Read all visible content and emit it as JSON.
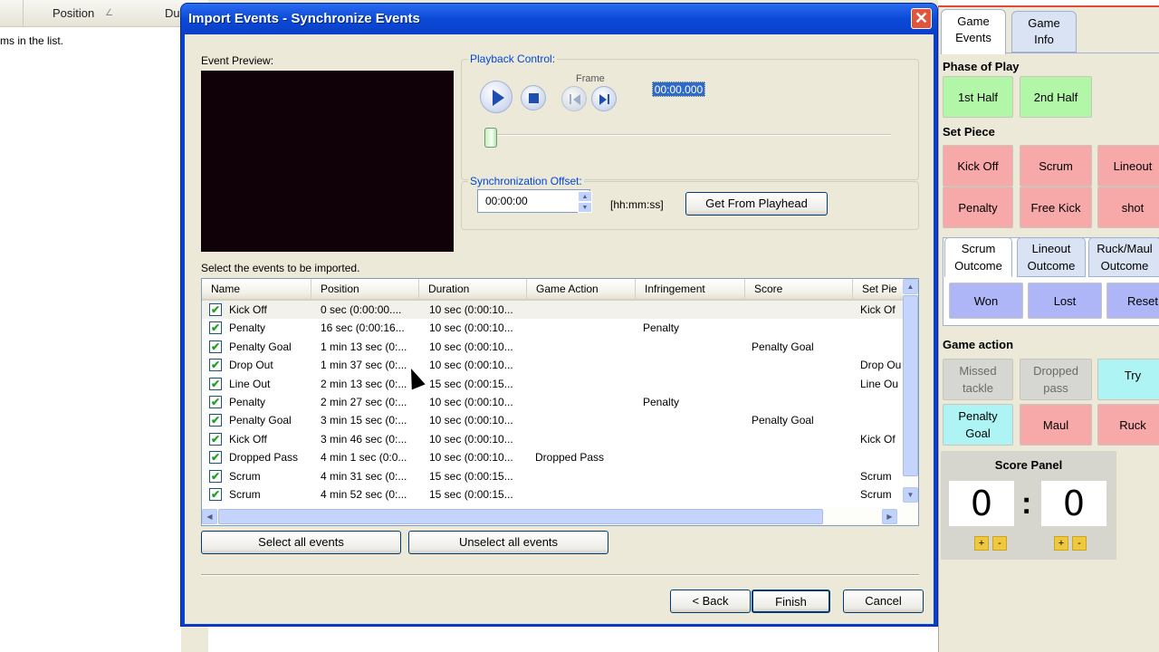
{
  "background": {
    "columns": [
      "Position",
      "Du"
    ],
    "empty_text": "ms in the list."
  },
  "dialog": {
    "title": "Import Events - Synchronize Events",
    "close_glyph": "✕",
    "event_preview_label": "Event Preview:",
    "playback": {
      "group_title": "Playback Control:",
      "frame_label": "Frame",
      "time": "00:00.000"
    },
    "sync": {
      "group_title": "Synchronization Offset:",
      "offset_value": "00:00:00",
      "format_label": "[hh:mm:ss]",
      "get_button": "Get From Playhead"
    },
    "select_label": "Select the events to be imported.",
    "columns": [
      "Name",
      "Position",
      "Duration",
      "Game Action",
      "Infringement",
      "Score",
      "Set Pie"
    ],
    "rows": [
      {
        "name": "Kick Off",
        "position": "0 sec (0:00:00....",
        "duration": "10 sec (0:00:10...",
        "action": "",
        "infringement": "",
        "score": "",
        "set": "Kick Of"
      },
      {
        "name": "Penalty",
        "position": "16 sec (0:00:16...",
        "duration": "10 sec (0:00:10...",
        "action": "",
        "infringement": "Penalty",
        "score": "",
        "set": ""
      },
      {
        "name": "Penalty Goal",
        "position": "1 min 13 sec (0:...",
        "duration": "10 sec (0:00:10...",
        "action": "",
        "infringement": "",
        "score": "Penalty Goal",
        "set": ""
      },
      {
        "name": "Drop Out",
        "position": "1 min 37 sec (0:...",
        "duration": "10 sec (0:00:10...",
        "action": "",
        "infringement": "",
        "score": "",
        "set": "Drop Ou"
      },
      {
        "name": "Line Out",
        "position": "2 min 13 sec (0:...",
        "duration": "15 sec (0:00:15...",
        "action": "",
        "infringement": "",
        "score": "",
        "set": "Line Ou"
      },
      {
        "name": "Penalty",
        "position": "2 min 27 sec (0:...",
        "duration": "10 sec (0:00:10...",
        "action": "",
        "infringement": "Penalty",
        "score": "",
        "set": ""
      },
      {
        "name": "Penalty Goal",
        "position": "3 min 15 sec (0:...",
        "duration": "10 sec (0:00:10...",
        "action": "",
        "infringement": "",
        "score": "Penalty Goal",
        "set": ""
      },
      {
        "name": "Kick Off",
        "position": "3 min 46 sec (0:...",
        "duration": "10 sec (0:00:10...",
        "action": "",
        "infringement": "",
        "score": "",
        "set": "Kick Of"
      },
      {
        "name": "Dropped Pass",
        "position": "4 min 1 sec (0:0...",
        "duration": "10 sec (0:00:10...",
        "action": "Dropped Pass",
        "infringement": "",
        "score": "",
        "set": ""
      },
      {
        "name": "Scrum",
        "position": "4 min 31 sec (0:...",
        "duration": "15 sec (0:00:15...",
        "action": "",
        "infringement": "",
        "score": "",
        "set": "Scrum"
      },
      {
        "name": "Scrum",
        "position": "4 min 52 sec (0:...",
        "duration": "15 sec (0:00:15...",
        "action": "",
        "infringement": "",
        "score": "",
        "set": "Scrum"
      }
    ],
    "select_all": "Select all events",
    "unselect_all": "Unselect all events",
    "back": "< Back",
    "finish": "Finish",
    "cancel": "Cancel"
  },
  "panel": {
    "tabs": [
      "Game\nEvents",
      "Game\nInfo"
    ],
    "phase_title": "Phase of Play",
    "phase_buttons": [
      "1st Half",
      "2nd Half"
    ],
    "set_piece_title": "Set Piece",
    "set_piece_buttons": [
      "Kick Off",
      "Scrum",
      "Lineout",
      "Penalty",
      "Free Kick",
      "shot"
    ],
    "outcome_tabs": [
      "Scrum\nOutcome",
      "Lineout\nOutcome",
      "Ruck/Maul\nOutcome"
    ],
    "outcome_buttons": [
      "Won",
      "Lost",
      "Reset"
    ],
    "game_action_title": "Game action",
    "game_action_buttons": [
      "Missed\ntackle",
      "Dropped\npass",
      "Try",
      "Penalty\nGoal",
      "Maul",
      "Ruck"
    ],
    "score_title": "Score Panel",
    "score_home": "0",
    "score_away": "0",
    "colon": ":",
    "plus": "+",
    "minus": "-"
  },
  "colors": {
    "title_bar": "#0a4ad8",
    "phase_green": "#b2f7a8",
    "set_piece_red": "#f7a8a8",
    "outcome_blue": "#aeb6f7",
    "action_cyan": "#aef4f4",
    "check_green": "#21a121"
  },
  "icons": [
    "play-icon",
    "stop-icon",
    "frame-back-icon",
    "frame-forward-icon",
    "close-icon",
    "checkbox-checked-icon",
    "scroll-up-icon",
    "scroll-down-icon",
    "scroll-left-icon",
    "scroll-right-icon",
    "mouse-cursor-icon"
  ]
}
